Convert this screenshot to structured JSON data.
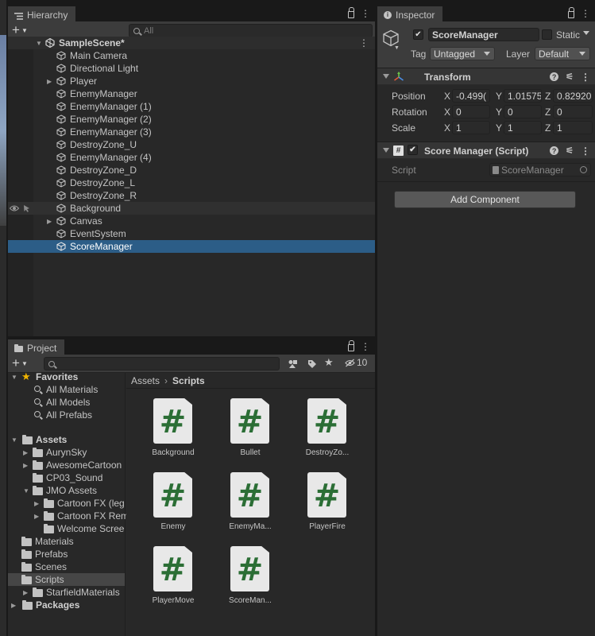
{
  "hierarchy": {
    "tab_label": "Hierarchy",
    "search_placeholder": "All",
    "scene_name": "SampleScene*",
    "items": [
      {
        "label": "Main Camera"
      },
      {
        "label": "Directional Light"
      },
      {
        "label": "Player"
      },
      {
        "label": "EnemyManager"
      },
      {
        "label": "EnemyManager (1)"
      },
      {
        "label": "EnemyManager (2)"
      },
      {
        "label": "EnemyManager (3)"
      },
      {
        "label": "DestroyZone_U"
      },
      {
        "label": "EnemyManager (4)"
      },
      {
        "label": "DestroyZone_D"
      },
      {
        "label": "DestroyZone_L"
      },
      {
        "label": "DestroyZone_R"
      },
      {
        "label": "Background"
      },
      {
        "label": "Canvas"
      },
      {
        "label": "EventSystem"
      },
      {
        "label": "ScoreManager"
      }
    ],
    "selected": "ScoreManager"
  },
  "inspector": {
    "tab_label": "Inspector",
    "object_name": "ScoreManager",
    "static_label": "Static",
    "tag_label": "Tag",
    "tag_value": "Untagged",
    "layer_label": "Layer",
    "layer_value": "Default",
    "transform": {
      "title": "Transform",
      "position_label": "Position",
      "rotation_label": "Rotation",
      "scale_label": "Scale",
      "position": {
        "x": "-0.499(",
        "y": "1.01575",
        "z": "0.82920"
      },
      "rotation": {
        "x": "0",
        "y": "0",
        "z": "0"
      },
      "scale": {
        "x": "1",
        "y": "1",
        "z": "1"
      }
    },
    "script_component": {
      "title": "Score Manager (Script)",
      "script_label": "Script",
      "script_value": "ScoreManager"
    },
    "add_component_label": "Add Component"
  },
  "project": {
    "tab_label": "Project",
    "hidden_count": "10",
    "tree": {
      "favorites_label": "Favorites",
      "favorites": [
        {
          "label": "All Materials"
        },
        {
          "label": "All Models"
        },
        {
          "label": "All Prefabs"
        }
      ],
      "assets_label": "Assets",
      "assets": [
        {
          "label": "AurynSky"
        },
        {
          "label": "AwesomeCartoon"
        },
        {
          "label": "CP03_Sound"
        },
        {
          "label": "JMO Assets"
        },
        {
          "label": "Cartoon FX (leg"
        },
        {
          "label": "Cartoon FX Rem"
        },
        {
          "label": "Welcome Scree"
        },
        {
          "label": "Materials"
        },
        {
          "label": "Prefabs"
        },
        {
          "label": "Scenes"
        },
        {
          "label": "Scripts"
        },
        {
          "label": "StarfieldMaterials"
        }
      ],
      "packages_label": "Packages"
    },
    "breadcrumb": {
      "root": "Assets",
      "current": "Scripts"
    },
    "files": [
      {
        "name": "Background"
      },
      {
        "name": "Bullet"
      },
      {
        "name": "DestroyZo..."
      },
      {
        "name": "Enemy"
      },
      {
        "name": "EnemyMa..."
      },
      {
        "name": "PlayerFire"
      },
      {
        "name": "PlayerMove"
      },
      {
        "name": "ScoreMan..."
      }
    ]
  }
}
